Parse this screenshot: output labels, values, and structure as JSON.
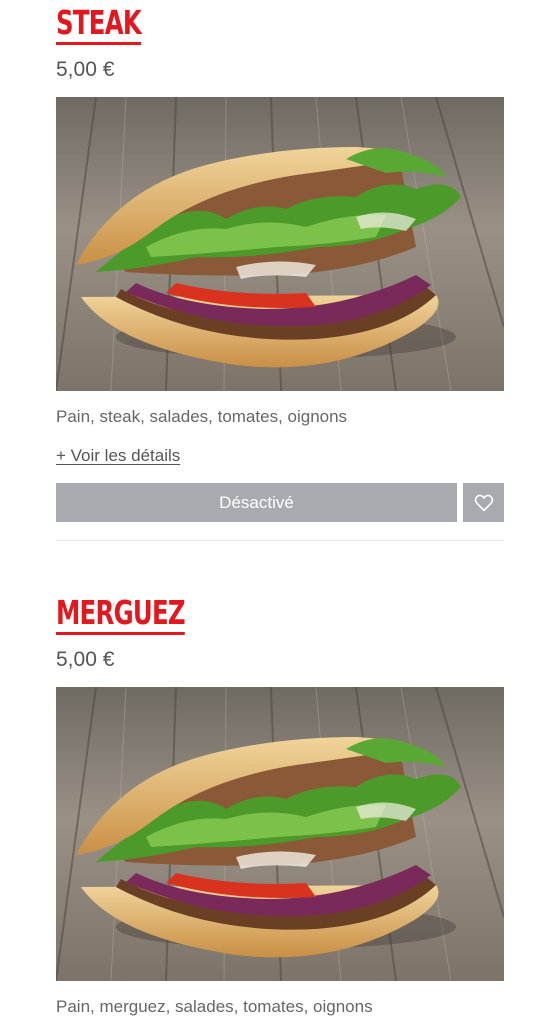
{
  "products": [
    {
      "name": "STEAK",
      "price": "5,00 €",
      "description": "Pain, steak, salades, tomates, oignons",
      "details_link": "+ Voir les détails",
      "button_label": "Désactivé",
      "favorite_icon": "heart-outline-icon"
    },
    {
      "name": "MERGUEZ",
      "price": "5,00 €",
      "description": "Pain, merguez, salades, tomates, oignons"
    }
  ],
  "colors": {
    "title": "#e3171e",
    "button_disabled": "#a7abb0",
    "text": "#555555"
  }
}
